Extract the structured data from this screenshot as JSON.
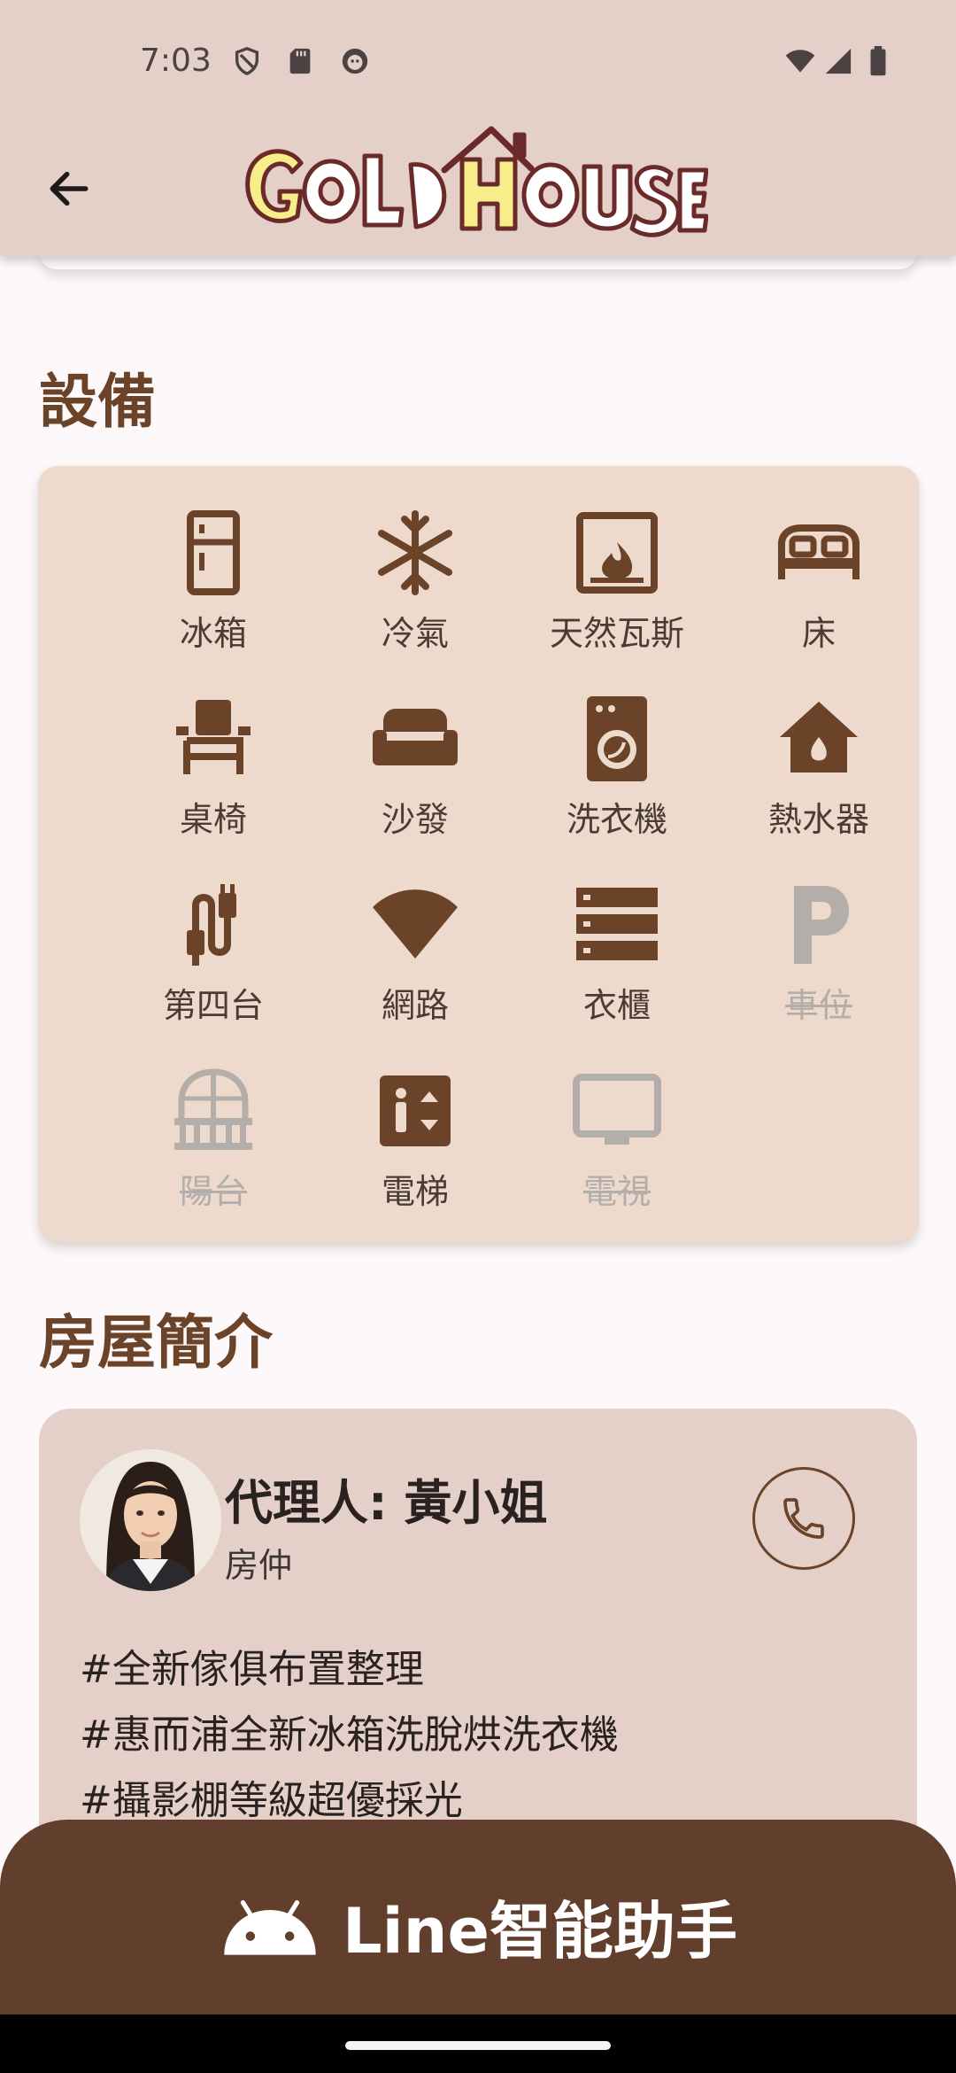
{
  "status_bar": {
    "time": "7:03"
  },
  "header": {
    "logo_text": "GOLD HOUSE"
  },
  "amenities": {
    "title": "設備",
    "items": [
      {
        "label": "冰箱",
        "icon": "fridge-icon",
        "available": true
      },
      {
        "label": "冷氣",
        "icon": "snowflake-icon",
        "available": true
      },
      {
        "label": "天然瓦斯",
        "icon": "gas-fireplace-icon",
        "available": true
      },
      {
        "label": "床",
        "icon": "bed-icon",
        "available": true
      },
      {
        "label": "桌椅",
        "icon": "chair-icon",
        "available": true
      },
      {
        "label": "沙發",
        "icon": "sofa-icon",
        "available": true
      },
      {
        "label": "洗衣機",
        "icon": "washing-machine-icon",
        "available": true
      },
      {
        "label": "熱水器",
        "icon": "water-heater-icon",
        "available": true
      },
      {
        "label": "第四台",
        "icon": "cable-icon",
        "available": true
      },
      {
        "label": "網路",
        "icon": "wifi-icon",
        "available": true
      },
      {
        "label": "衣櫃",
        "icon": "wardrobe-icon",
        "available": true
      },
      {
        "label": "車位",
        "icon": "parking-icon",
        "available": false
      },
      {
        "label": "陽台",
        "icon": "balcony-icon",
        "available": false
      },
      {
        "label": "電梯",
        "icon": "elevator-icon",
        "available": true
      },
      {
        "label": "電視",
        "icon": "tv-icon",
        "available": false
      }
    ]
  },
  "intro": {
    "title": "房屋簡介",
    "agent_name": "代理人: 黃小姐",
    "agent_role": "房仲",
    "tags": [
      "#全新傢俱布置整理",
      "#惠而浦全新冰箱洗脫烘洗衣機",
      "#攝影棚等級超優採光"
    ]
  },
  "assistant": {
    "label": "Line智能助手"
  },
  "colors": {
    "brand_brown": "#623e2c",
    "accent": "#6a4329",
    "card": "#eedacd",
    "header": "#e4d0c8",
    "disabled": "#b3aeaa"
  }
}
